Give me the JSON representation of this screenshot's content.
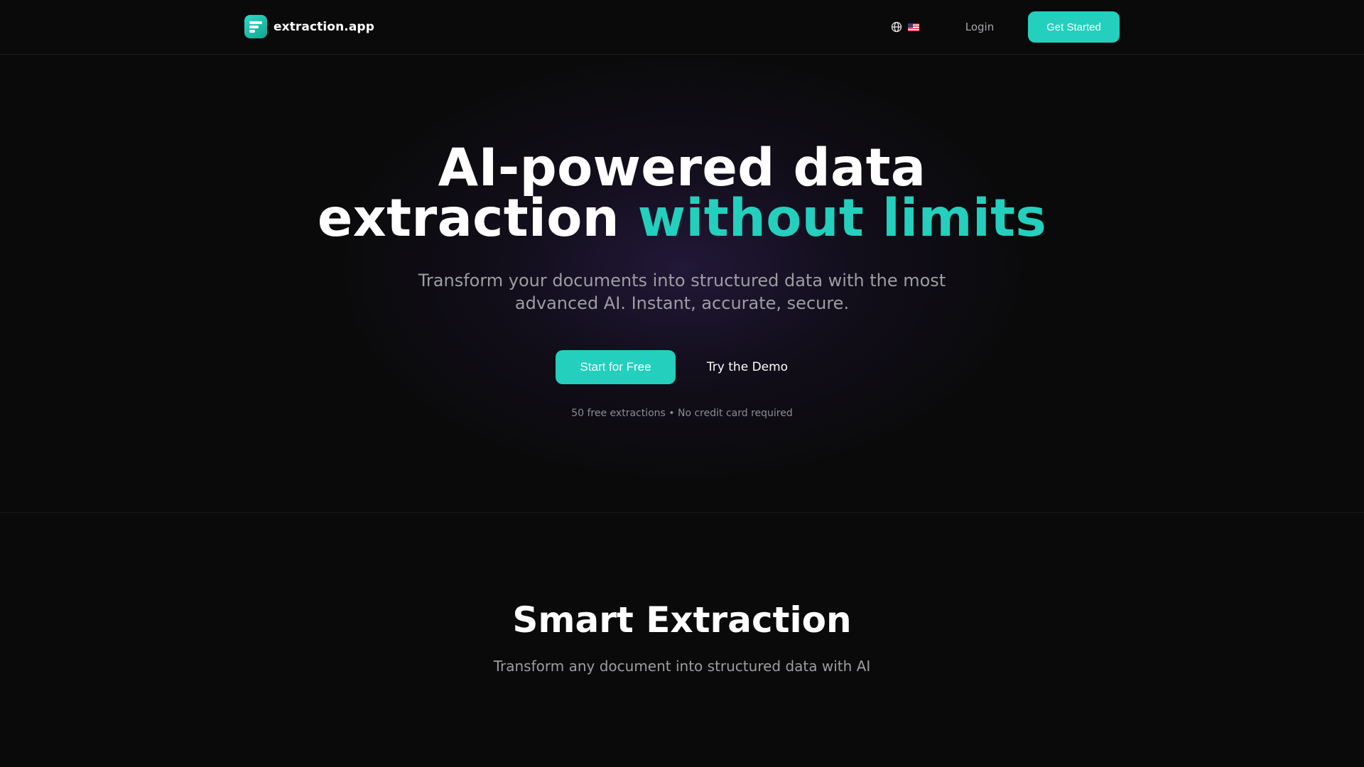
{
  "header": {
    "brand_name": "extraction.app",
    "language_flag": "US",
    "login_label": "Login",
    "cta_label": "Get Started"
  },
  "hero": {
    "title_line1": "AI-powered data",
    "title_line2_plain": "extraction",
    "title_line2_accent": "without limits",
    "subtitle_line1": "Transform your documents into structured data with the most",
    "subtitle_line2": "advanced AI. Instant, accurate, secure.",
    "primary_button": "Start for Free",
    "secondary_button": "Try the Demo",
    "note": "50 free extractions • No credit card required"
  },
  "features": {
    "title": "Smart Extraction",
    "subtitle": "Transform any document into structured data with AI"
  },
  "colors": {
    "background": "#0a0a0a",
    "accent": "#24cfbd",
    "text_primary": "#ffffff",
    "text_muted": "#9d9da2"
  },
  "icons": {
    "logo": "document-lines-icon",
    "language": "globe-icon"
  }
}
